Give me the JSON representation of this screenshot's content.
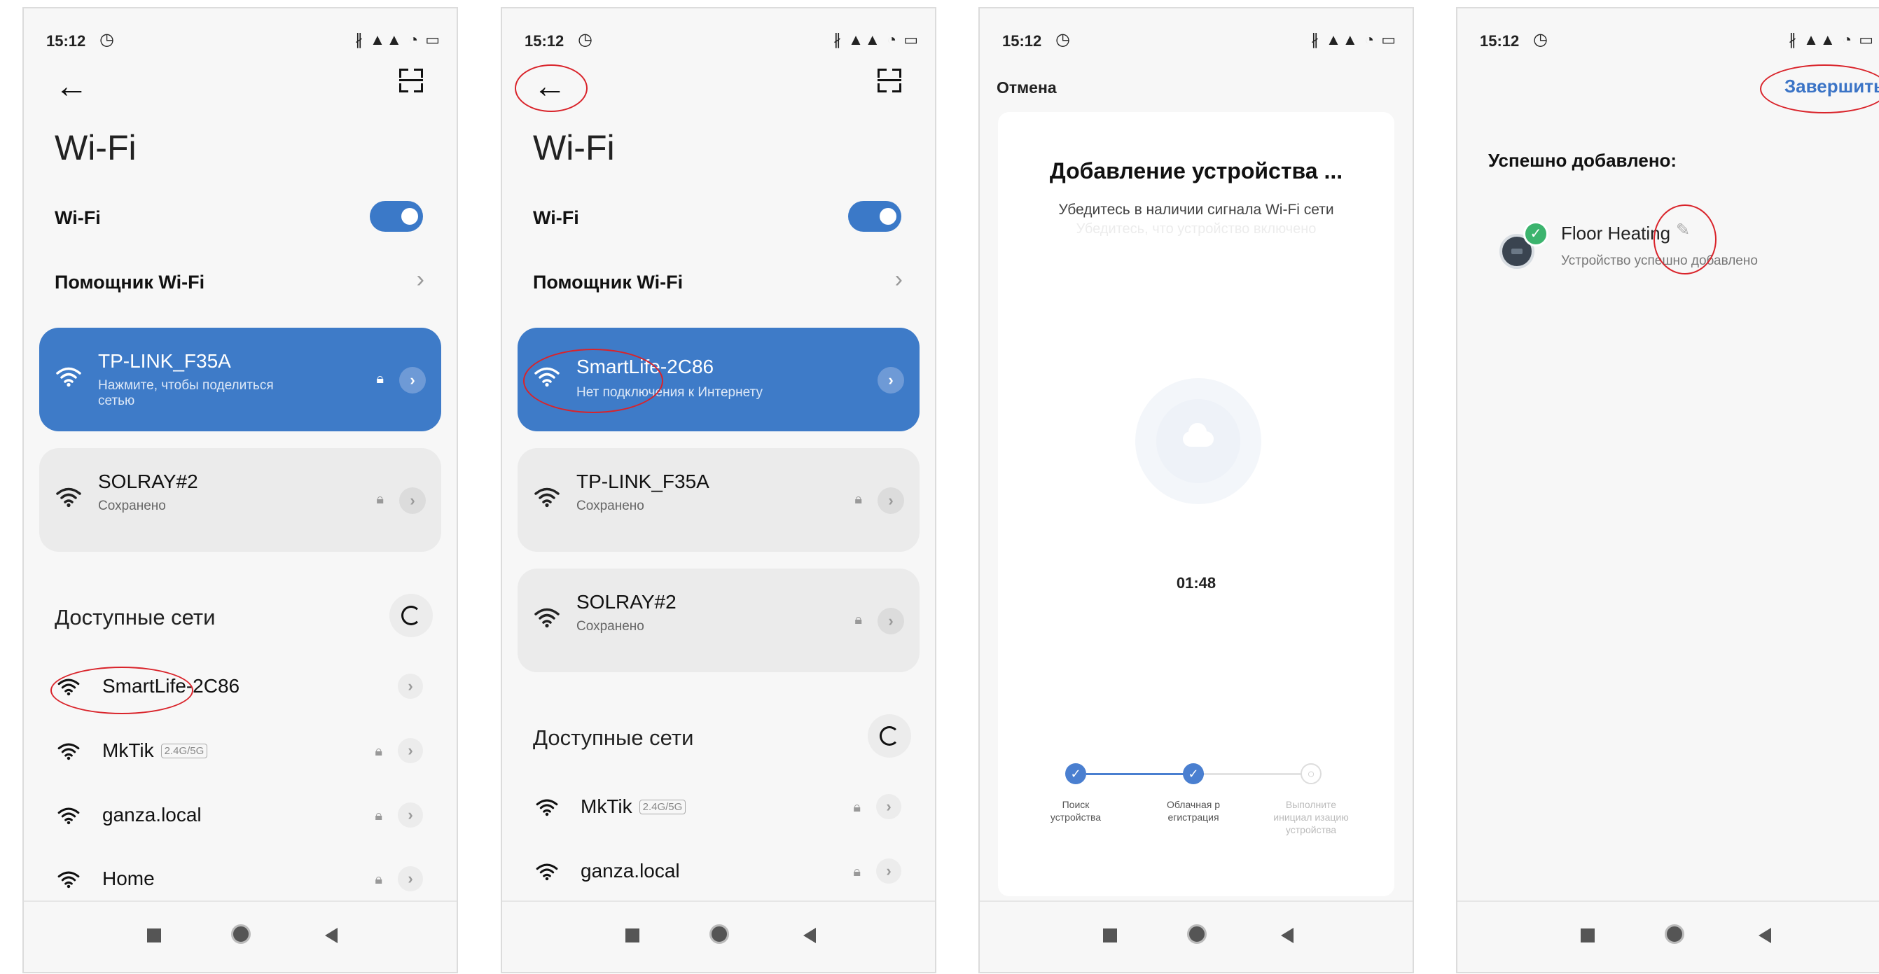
{
  "status": {
    "time": "15:12",
    "alarm": "◷",
    "icons": "∦ ▲▲ ◔ ▭"
  },
  "wifi": {
    "title": "Wi-Fi",
    "toggle_label": "Wi-Fi",
    "assistant_label": "Помощник Wi-Fi",
    "available_title": "Доступные сети"
  },
  "screen1": {
    "connected": {
      "ssid": "TP-LINK_F35A",
      "sub": "Нажмите, чтобы поделиться сетью"
    },
    "saved": [
      {
        "ssid": "SOLRAY#2",
        "sub": "Сохранено"
      }
    ],
    "networks": [
      {
        "ssid": "SmartLife-2C86",
        "badge": ""
      },
      {
        "ssid": "MkTik",
        "badge": "2.4G/5G"
      },
      {
        "ssid": "ganza.local",
        "badge": ""
      },
      {
        "ssid": "Home",
        "badge": ""
      }
    ]
  },
  "screen2": {
    "connected": {
      "ssid": "SmartLife-2C86",
      "sub": "Нет подключения к Интернету"
    },
    "saved": [
      {
        "ssid": "TP-LINK_F35A",
        "sub": "Сохранено"
      },
      {
        "ssid": "SOLRAY#2",
        "sub": "Сохранено"
      }
    ],
    "networks": [
      {
        "ssid": "MkTik",
        "badge": "2.4G/5G"
      },
      {
        "ssid": "ganza.local",
        "badge": ""
      }
    ]
  },
  "screen3": {
    "cancel": "Отмена",
    "title": "Добавление устройства ...",
    "subtitle": "Убедитесь в наличии сигнала Wi-Fi сети",
    "faded": "Убедитесь, что устройство включено",
    "timer": "01:48",
    "steps": [
      {
        "label": "Поиск устройства",
        "done": true
      },
      {
        "label": "Облачная р егистрация",
        "done": true
      },
      {
        "label": "Выполните инициал изацию устройства",
        "done": false
      }
    ]
  },
  "screen4": {
    "finish": "Завершить",
    "success_title": "Успешно добавлено:",
    "device_name": "Floor Heating",
    "device_status": "Устройство успешно добавлено"
  },
  "colors": {
    "accent": "#3e7bc8",
    "annotation": "#d9232a",
    "success": "#3cb46e",
    "link": "#3b74c6"
  }
}
